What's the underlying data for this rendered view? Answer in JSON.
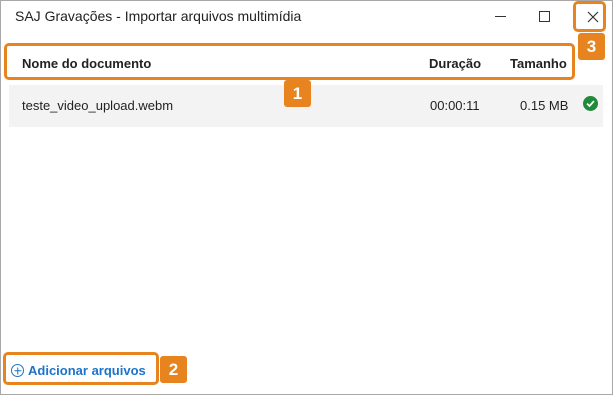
{
  "window": {
    "title": "SAJ Gravações - Importar arquivos multimídia"
  },
  "table": {
    "columns": {
      "name": "Nome do documento",
      "duration": "Duração",
      "size": "Tamanho"
    },
    "rows": [
      {
        "name": "teste_video_upload.webm",
        "duration": "00:00:11",
        "size": "0.15 MB",
        "status_icon": "check-circle-icon"
      }
    ]
  },
  "actions": {
    "add_files": "Adicionar arquivos",
    "add_files_icon": "plus-circle-icon"
  },
  "annotations": [
    "1",
    "2",
    "3"
  ],
  "colors": {
    "callout": "#e8841f",
    "link": "#1a74c9",
    "success": "#1f8a3a",
    "row_bg": "#f3f3f3"
  }
}
